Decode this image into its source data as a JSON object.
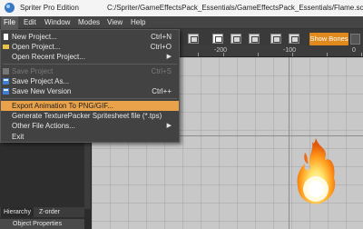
{
  "window": {
    "app_name": "Spriter Pro Edition",
    "file_path": "C:/Spriter/GameEffectsPack_Essentials/GameEffectsPack_Essentials/Flame.scml"
  },
  "menubar": {
    "items": [
      "File",
      "Edit",
      "Window",
      "Modes",
      "View",
      "Help"
    ],
    "active": "File"
  },
  "toolbar": {
    "show_bones_label": "Show Bones"
  },
  "ruler": {
    "labels": [
      "-200",
      "-100",
      "0"
    ]
  },
  "file_menu": {
    "items": [
      {
        "label": "New Project...",
        "shortcut": "Ctrl+N",
        "icon": "new-document-icon",
        "state": "normal"
      },
      {
        "label": "Open Project...",
        "shortcut": "Ctrl+O",
        "icon": "open-folder-icon",
        "state": "normal"
      },
      {
        "label": "Open Recent Project...",
        "shortcut": "",
        "icon": "",
        "state": "submenu"
      },
      {
        "label": "Save Project",
        "shortcut": "Ctrl+S",
        "icon": "save-icon",
        "state": "disabled"
      },
      {
        "label": "Save Project As...",
        "shortcut": "",
        "icon": "save-as-icon",
        "state": "normal"
      },
      {
        "label": "Save New Version",
        "shortcut": "Ctrl++",
        "icon": "save-version-icon",
        "state": "normal"
      },
      {
        "label": "Export Animation To PNG/GIF...",
        "shortcut": "",
        "icon": "",
        "state": "highlighted"
      },
      {
        "label": "Generate TexturePacker Spritesheet file (*.tps)",
        "shortcut": "",
        "icon": "",
        "state": "normal"
      },
      {
        "label": "Other File Actions...",
        "shortcut": "",
        "icon": "",
        "state": "submenu"
      },
      {
        "label": "Exit",
        "shortcut": "",
        "icon": "",
        "state": "normal"
      }
    ]
  },
  "panels": {
    "tabs": [
      "Hierarchy",
      "Z-order"
    ],
    "active_tab": "Hierarchy",
    "object_properties_title": "Object Properties"
  },
  "colors": {
    "accent": "#e08a1e",
    "menu_highlight": "#e9a24a",
    "canvas_bg": "#c8c8c8"
  }
}
